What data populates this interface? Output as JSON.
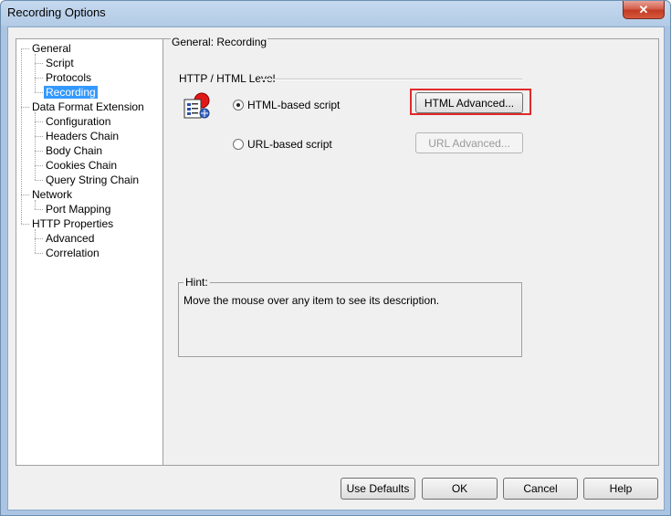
{
  "window": {
    "title": "Recording Options",
    "close_glyph": "✕"
  },
  "tree": {
    "items": [
      {
        "label": "General",
        "level": 0
      },
      {
        "label": "Script",
        "level": 1
      },
      {
        "label": "Protocols",
        "level": 1
      },
      {
        "label": "Recording",
        "level": 1,
        "selected": true
      },
      {
        "label": "Data Format Extension",
        "level": 0
      },
      {
        "label": "Configuration",
        "level": 1
      },
      {
        "label": "Headers Chain",
        "level": 1
      },
      {
        "label": "Body Chain",
        "level": 1
      },
      {
        "label": "Cookies Chain",
        "level": 1
      },
      {
        "label": "Query String Chain",
        "level": 1
      },
      {
        "label": "Network",
        "level": 0
      },
      {
        "label": "Port Mapping",
        "level": 1
      },
      {
        "label": "HTTP Properties",
        "level": 0
      },
      {
        "label": "Advanced",
        "level": 1
      },
      {
        "label": "Correlation",
        "level": 1
      }
    ]
  },
  "panel": {
    "title": "General: Recording",
    "group_label": "HTTP / HTML Level",
    "icon": "script-document-icon",
    "html_radio": {
      "label": "HTML-based script",
      "checked": true
    },
    "url_radio": {
      "label": "URL-based script",
      "checked": false
    },
    "html_advanced_button": "HTML Advanced...",
    "url_advanced_button": "URL Advanced...",
    "hint": {
      "title": "Hint:",
      "text": "Move the mouse over any item to see its description."
    }
  },
  "buttons": {
    "use_defaults": "Use Defaults",
    "ok": "OK",
    "cancel": "Cancel",
    "help": "Help"
  },
  "colors": {
    "highlight": "#e02a2a",
    "selection": "#3399ff"
  }
}
